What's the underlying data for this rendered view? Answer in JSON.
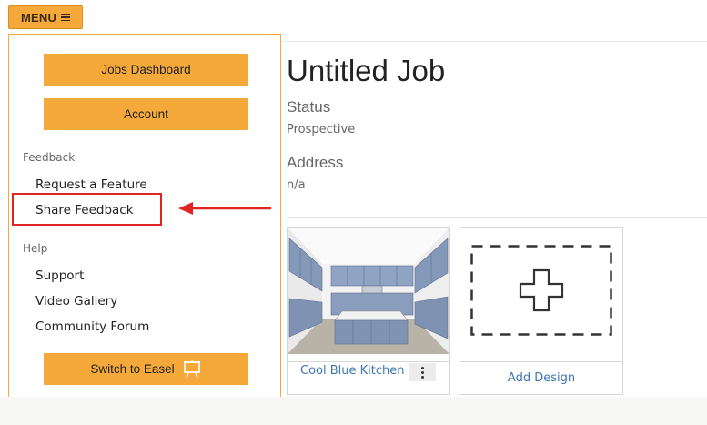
{
  "header": {
    "menu_label": "MENU",
    "menu_icon": "hamburger-icon"
  },
  "sidebar": {
    "buttons": {
      "jobs_dashboard": "Jobs Dashboard",
      "account": "Account",
      "switch_to_easel": "Switch to Easel"
    },
    "sections": {
      "feedback": {
        "label": "Feedback",
        "items": [
          "Request a Feature",
          "Share Feedback"
        ]
      },
      "help": {
        "label": "Help",
        "items": [
          "Support",
          "Video Gallery",
          "Community Forum"
        ]
      }
    },
    "highlighted_item": "Share Feedback",
    "easel_icon": "easel-icon"
  },
  "job": {
    "title": "Untitled Job",
    "status_label": "Status",
    "status_value": "Prospective",
    "address_label": "Address",
    "address_value": "n/a"
  },
  "designs": [
    {
      "title": "Cool Blue Kitchen",
      "thumbnail": "kitchen-render",
      "menu_icon": "vertical-dots-icon"
    },
    {
      "title": "Add Design",
      "icon": "plus-icon"
    }
  ],
  "colors": {
    "accent": "#f4a93a",
    "link": "#3b76b5",
    "annotation_red": "#e02424"
  }
}
